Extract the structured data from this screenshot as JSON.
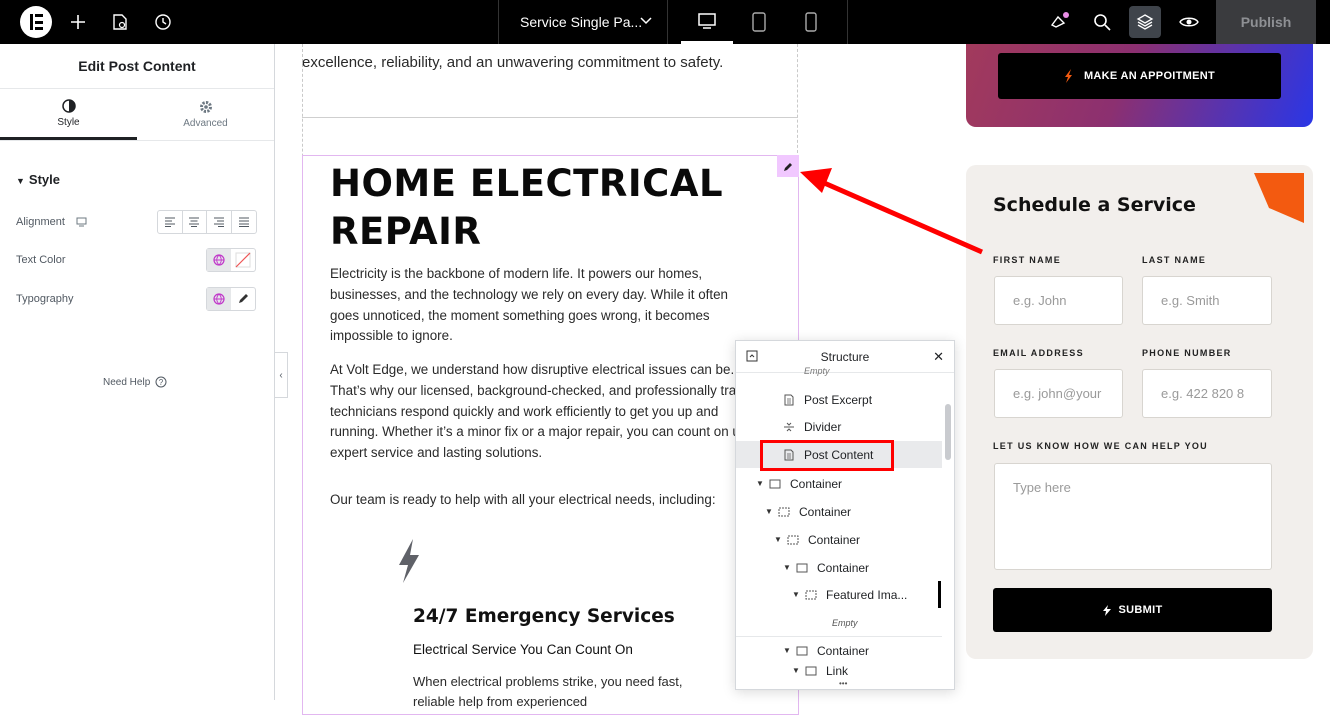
{
  "topbar": {
    "doc_title": "Service Single Pa...",
    "publish_label": "Publish",
    "icons": [
      "elementor-logo-icon",
      "add-icon",
      "page-settings-icon",
      "history-icon",
      "chevron-down-icon",
      "desktop-icon",
      "tablet-icon",
      "mobile-icon",
      "whats-new-icon",
      "search-icon",
      "structure-icon",
      "preview-icon"
    ]
  },
  "panel": {
    "title": "Edit Post Content",
    "tabs": [
      {
        "label": "Style"
      },
      {
        "label": "Advanced"
      }
    ],
    "section": "Style",
    "controls": {
      "alignment": "Alignment",
      "text_color": "Text Color",
      "typography": "Typography"
    },
    "need_help": "Need Help"
  },
  "canvas": {
    "intro_tail": "excellence, reliability, and an unwavering commitment to safety.",
    "heading": "HOME ELECTRICAL REPAIR",
    "para1": "Electricity is the backbone of modern life. It powers our homes, businesses, and the technology we rely on every day. While it often goes unnoticed, the moment something goes wrong, it becomes impossible to ignore.",
    "para2": "At Volt Edge, we understand how disruptive electrical issues can be. That’s why our licensed, background-checked, and professionally trained technicians respond quickly and work efficiently to get you up and running. Whether it’s a minor fix or a major repair, you can count on us for expert service and lasting solutions.",
    "para3": "Our team is ready to help with all your electrical needs, including:",
    "feature_title": "24/7 Emergency Services",
    "feature_sub": "Electrical Service You Can Count On",
    "feature_text": "When electrical problems strike, you need fast, reliable help from experienced"
  },
  "sidebar_form": {
    "appointment_button": "MAKE AN APPOITMENT",
    "title": "Schedule a Service",
    "first_name_label": "FIRST NAME",
    "first_name_placeholder": "e.g. John",
    "last_name_label": "LAST NAME",
    "last_name_placeholder": "e.g. Smith",
    "email_label": "EMAIL ADDRESS",
    "email_placeholder": "e.g. john@your",
    "phone_label": "PHONE NUMBER",
    "phone_placeholder": "e.g. 422 820 8",
    "message_label": "LET US KNOW HOW WE CAN HELP YOU",
    "message_placeholder": "Type here",
    "submit_label": "SUBMIT"
  },
  "structure": {
    "title": "Structure",
    "items": [
      {
        "label": "Empty",
        "italic": true
      },
      {
        "label": "Post Excerpt"
      },
      {
        "label": "Divider"
      },
      {
        "label": "Post Content",
        "selected": true
      },
      {
        "label": "Container"
      },
      {
        "label": "Container"
      },
      {
        "label": "Container"
      },
      {
        "label": "Container"
      },
      {
        "label": "Featured Ima..."
      },
      {
        "label": "Empty",
        "italic": true
      },
      {
        "label": "Container"
      },
      {
        "label": "Link"
      }
    ]
  },
  "colors": {
    "highlight_box": "#ff0000",
    "selection": "#e2b7f0",
    "accent_orange": "#f35a10"
  }
}
